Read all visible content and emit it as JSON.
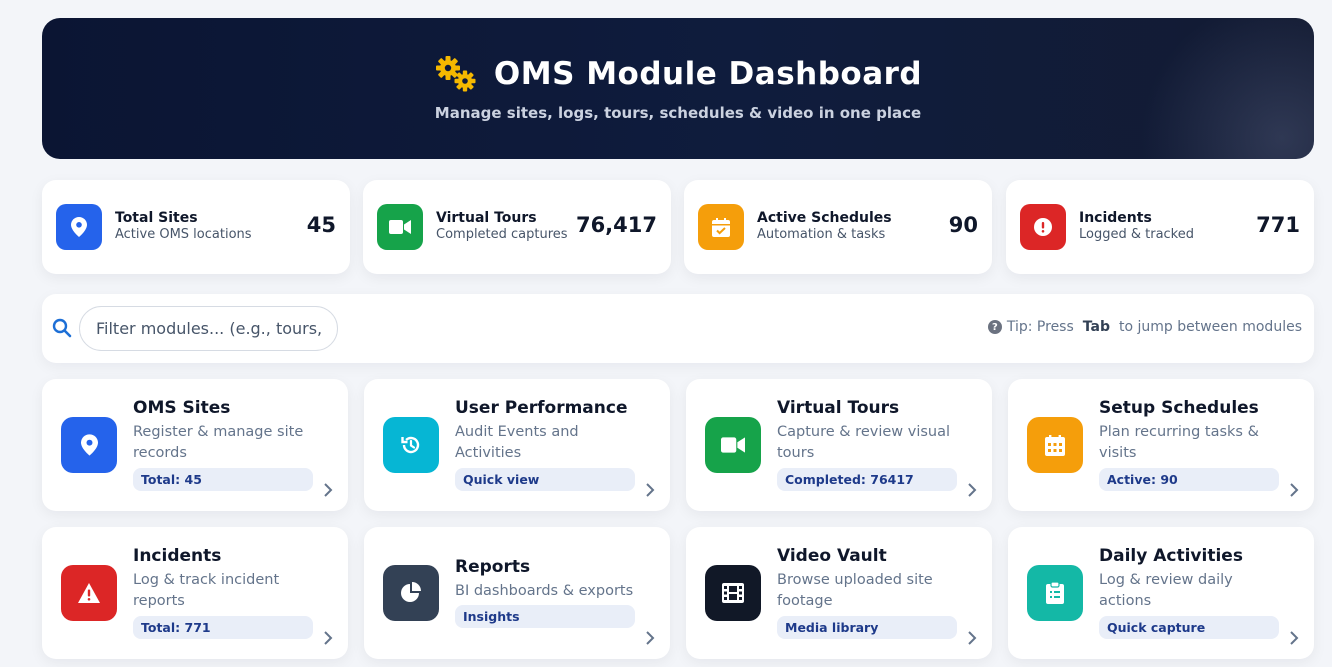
{
  "header": {
    "icon": "gears-icon",
    "title": "OMS Module Dashboard",
    "subtitle": "Manage sites, logs, tours, schedules & video in one place"
  },
  "stats": [
    {
      "title": "Total Sites",
      "subtitle": "Active OMS locations",
      "value": "45",
      "icon": "location-pin-icon",
      "color": "#2563eb"
    },
    {
      "title": "Virtual Tours",
      "subtitle": "Completed captures",
      "value": "76,417",
      "icon": "video-camera-icon",
      "color": "#16a34a"
    },
    {
      "title": "Active Schedules",
      "subtitle": "Automation & tasks",
      "value": "90",
      "icon": "calendar-check-icon",
      "color": "#f59e0b"
    },
    {
      "title": "Incidents",
      "subtitle": "Logged & tracked",
      "value": "771",
      "icon": "alert-circle-icon",
      "color": "#dc2626"
    }
  ],
  "filter": {
    "placeholder": "Filter modules... (e.g., tours, logs, video)",
    "tip_prefix": "Tip: Press",
    "tip_key": "Tab",
    "tip_suffix": "to jump between modules"
  },
  "modules": [
    {
      "title": "OMS Sites",
      "desc": "Register & manage site records",
      "badge": "Total: 45",
      "icon": "location-pin-icon",
      "color": "#2563eb"
    },
    {
      "title": "User Performance",
      "desc": "Audit Events and Activities",
      "badge": "Quick view",
      "icon": "history-icon",
      "color": "#06b6d4"
    },
    {
      "title": "Virtual Tours",
      "desc": "Capture & review visual tours",
      "badge": "Completed: 76417",
      "icon": "video-camera-icon",
      "color": "#16a34a"
    },
    {
      "title": "Setup Schedules",
      "desc": "Plan recurring tasks & visits",
      "badge": "Active: 90",
      "icon": "calendar-grid-icon",
      "color": "#f59e0b"
    },
    {
      "title": "Incidents",
      "desc": "Log & track incident reports",
      "badge": "Total: 771",
      "icon": "warning-triangle-icon",
      "color": "#dc2626"
    },
    {
      "title": "Reports",
      "desc": "BI dashboards & exports",
      "badge": "Insights",
      "icon": "pie-chart-icon",
      "color": "#334155"
    },
    {
      "title": "Video Vault",
      "desc": "Browse uploaded site footage",
      "badge": "Media library",
      "icon": "film-icon",
      "color": "#111827"
    },
    {
      "title": "Daily Activities",
      "desc": "Log & review daily actions",
      "badge": "Quick capture",
      "icon": "clipboard-list-icon",
      "color": "#14b8a6"
    }
  ]
}
